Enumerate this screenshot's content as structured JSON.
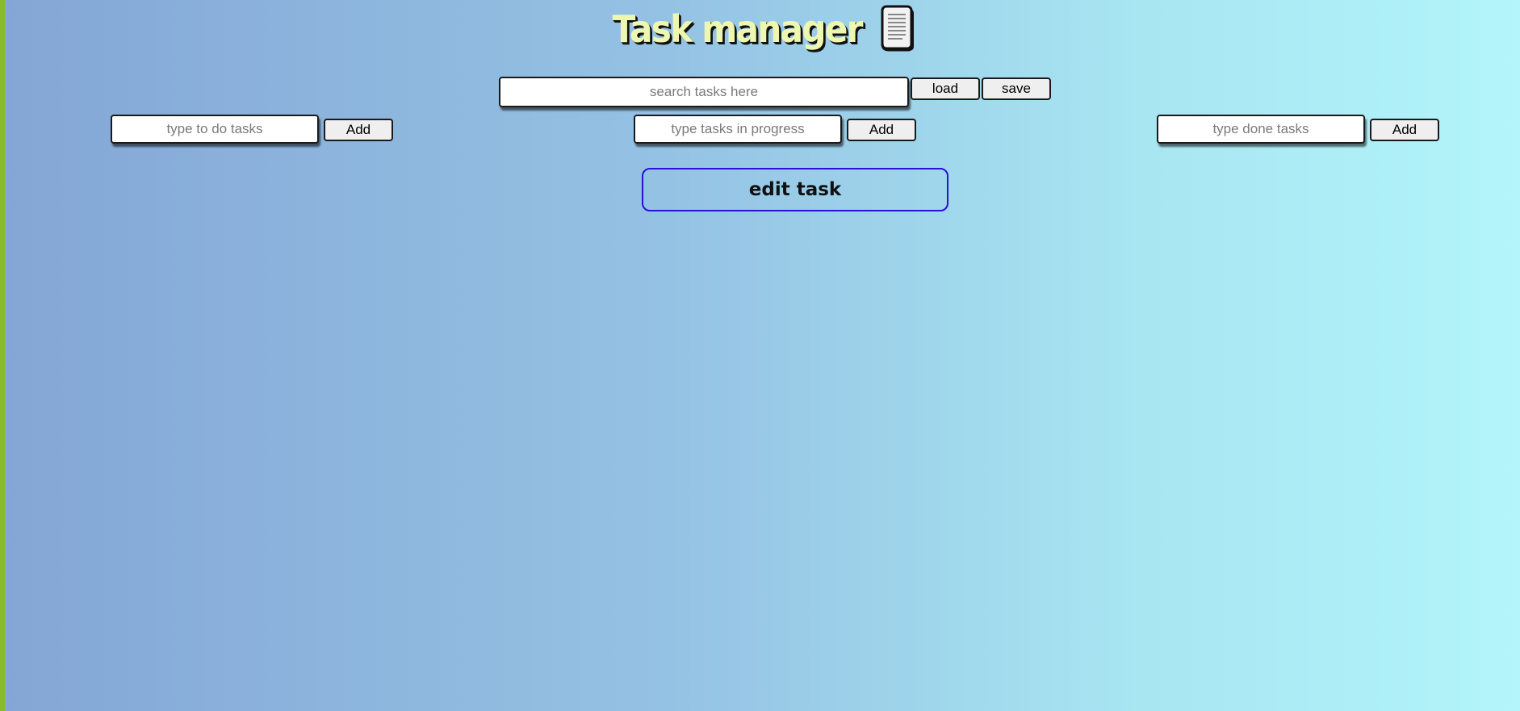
{
  "header": {
    "title": "Task manager",
    "icon": "scroll-document-icon"
  },
  "search": {
    "placeholder": "search tasks here",
    "value": "",
    "load_label": "load",
    "save_label": "save"
  },
  "columns": {
    "todo": {
      "placeholder": "type to do tasks",
      "value": "",
      "add_label": "Add"
    },
    "in_progress": {
      "placeholder": "type tasks in progress",
      "value": "",
      "add_label": "Add"
    },
    "done": {
      "placeholder": "type done tasks",
      "value": "",
      "add_label": "Add"
    }
  },
  "edit": {
    "label": "edit task"
  },
  "colors": {
    "gradient_start": "#84a6d6",
    "gradient_end": "#b2f5fa",
    "left_edge": "#8ab832",
    "title_fill": "#eef7b0",
    "edit_border": "#2a10d8"
  }
}
